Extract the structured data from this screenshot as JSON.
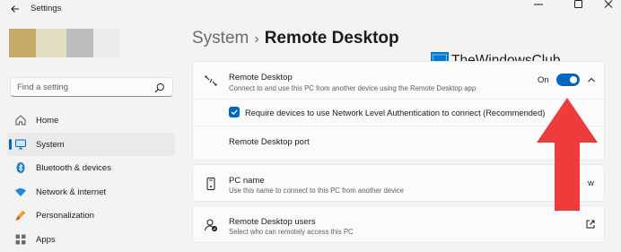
{
  "window": {
    "title": "Settings"
  },
  "search": {
    "placeholder": "Find a setting"
  },
  "profile": {
    "colors": [
      "#c8aa68",
      "#e2dfc3",
      "#bdbdbd",
      "#ebebeb"
    ]
  },
  "nav": {
    "items": [
      {
        "label": "Home",
        "icon": "home-icon",
        "active": false
      },
      {
        "label": "System",
        "icon": "system-icon",
        "active": true
      },
      {
        "label": "Bluetooth & devices",
        "icon": "bluetooth-icon",
        "active": false
      },
      {
        "label": "Network & internet",
        "icon": "wifi-icon",
        "active": false
      },
      {
        "label": "Personalization",
        "icon": "brush-icon",
        "active": false
      },
      {
        "label": "Apps",
        "icon": "apps-icon",
        "active": false
      }
    ]
  },
  "breadcrumb": {
    "parent": "System",
    "separator": "›",
    "current": "Remote Desktop"
  },
  "remote_desktop": {
    "title": "Remote Desktop",
    "subtitle": "Connect to and use this PC from another device using the Remote Desktop app",
    "toggle_label": "On",
    "toggle_on": true,
    "nla_label": "Require devices to use Network Level Authentication to connect (Recommended)",
    "nla_checked": true,
    "port_label": "Remote Desktop port"
  },
  "pc_name": {
    "title": "PC name",
    "subtitle": "Use this name to connect to this PC from another device",
    "rename_partial": "w"
  },
  "users": {
    "title": "Remote Desktop users",
    "subtitle": "Select who can remotely access this PC"
  },
  "watermark": {
    "text": "TheWindowsClub"
  },
  "colors": {
    "accent": "#0067c0",
    "arrow": "#ee3b3b",
    "background": "#f3f3f3",
    "card": "#fbfbfb"
  }
}
